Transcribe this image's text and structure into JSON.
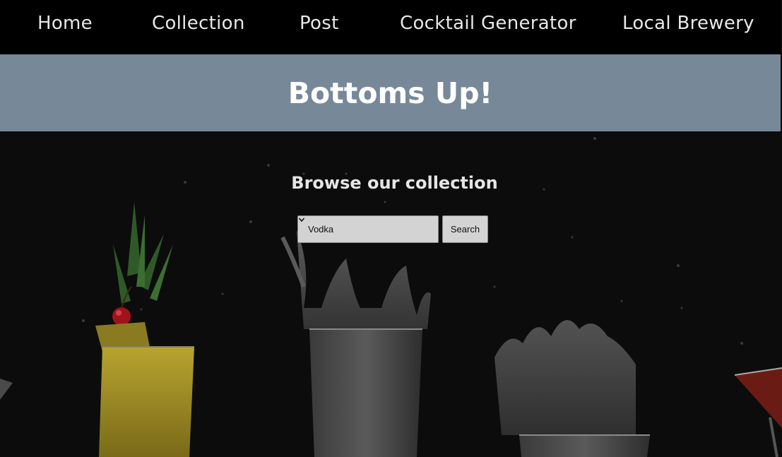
{
  "nav": {
    "items": [
      {
        "label": "Home"
      },
      {
        "label": "Collection"
      },
      {
        "label": "Post"
      },
      {
        "label": "Cocktail Generator"
      },
      {
        "label": "Local Brewery"
      }
    ]
  },
  "banner": {
    "title": "Bottoms Up!"
  },
  "collection": {
    "heading": "Browse our collection",
    "select_value": "Vodka",
    "search_label": "Search"
  },
  "colors": {
    "nav_background": "#000000",
    "banner_background": "#778899",
    "hero_background": "#0c0c0c",
    "control_background": "#d3d3d3"
  }
}
